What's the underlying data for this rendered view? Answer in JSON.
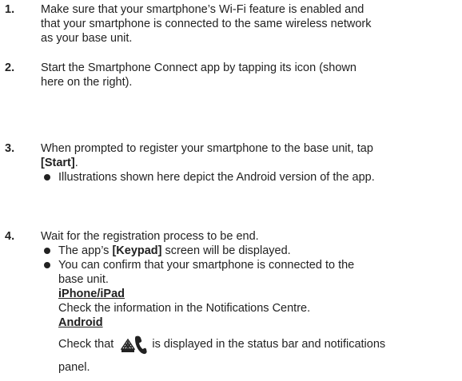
{
  "steps": [
    {
      "number": "1.",
      "lines": [
        "Make sure that your smartphone’s Wi-Fi feature is enabled and",
        "that your smartphone is connected to the same wireless network",
        "as your base unit."
      ]
    },
    {
      "number": "2.",
      "lines": [
        "Start the Smartphone Connect app by tapping its icon (shown",
        "here on the right)."
      ]
    },
    {
      "number": "3.",
      "line1": "When prompted to register your smartphone to the base unit, tap",
      "bold": "[Start]",
      "bold_suffix": ".",
      "bullet": "Illustrations shown here depict the Android version of the app."
    },
    {
      "number": "4.",
      "line1": "Wait for the registration process to be end.",
      "bullet1_prefix": "The app’s ",
      "bullet1_bold": "[Keypad]",
      "bullet1_suffix": " screen will be displayed.",
      "bullet2_line1": "You can confirm that your smartphone is connected to the",
      "bullet2_line2": "base unit.",
      "iphone_heading": "iPhone/iPad",
      "iphone_text": "Check the information in the Notifications Centre.",
      "android_heading": "Android",
      "android_prefix": "Check that ",
      "android_suffix": " is displayed in the status bar and notifications",
      "android_line2": "panel.",
      "android_icon": "base-unit-connected-icon"
    }
  ]
}
